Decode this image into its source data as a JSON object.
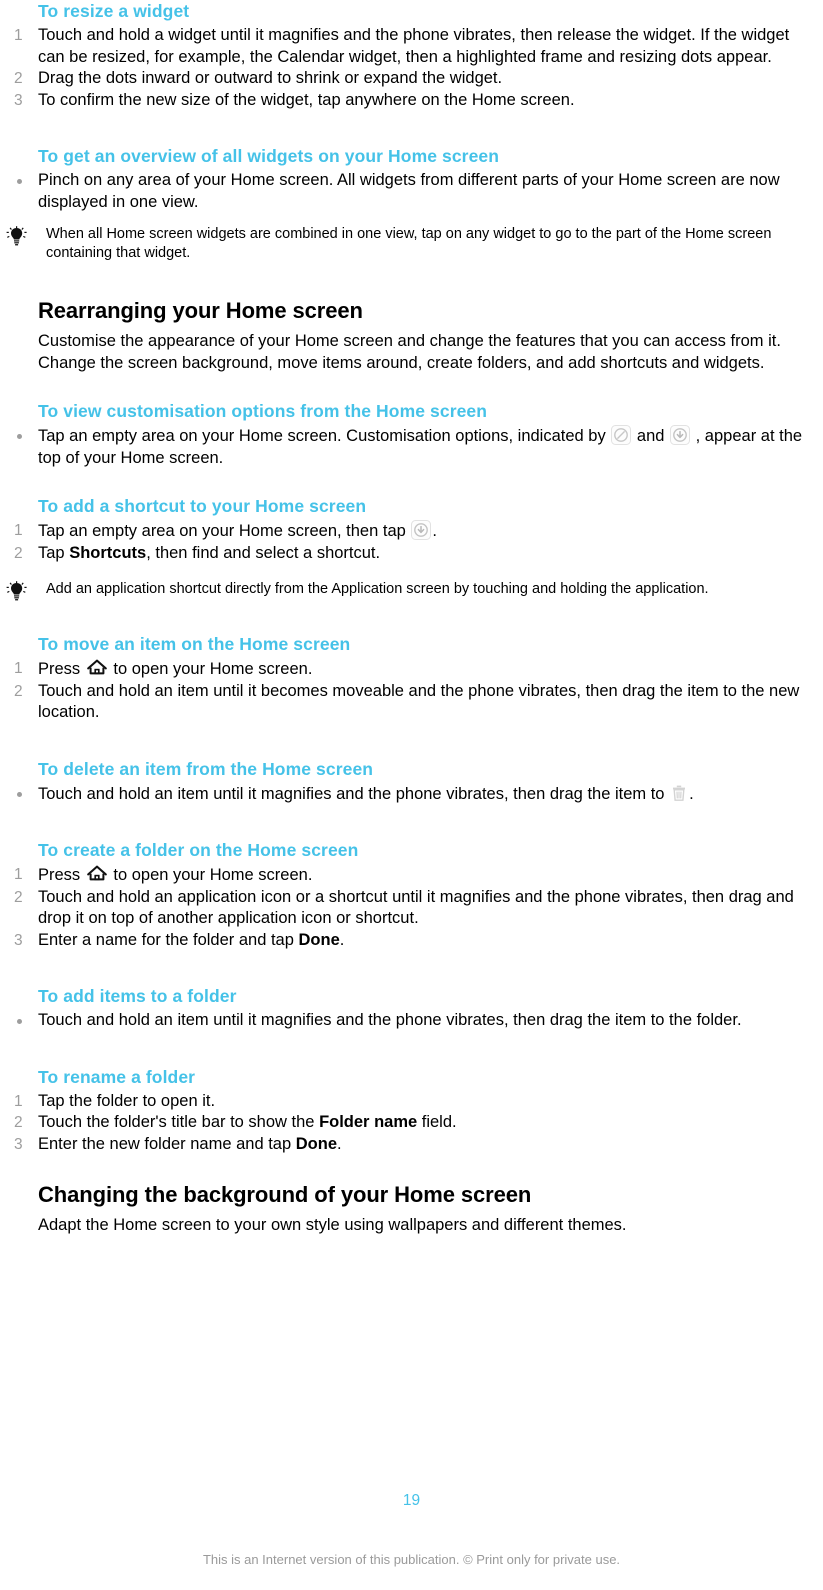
{
  "theme": {
    "heading_blue": "#45c2e8",
    "list_marker_grey": "#9d9d9d",
    "footer_grey": "#9a9a9a",
    "body_black": "#000000",
    "page_background": "#ffffff"
  },
  "sections": {
    "resize_widget": {
      "heading": "To resize a widget",
      "steps": [
        {
          "marker": "1",
          "text": "Touch and hold a widget until it magnifies and the phone vibrates, then release the widget. If the widget can be resized, for example, the Calendar widget, then a highlighted frame and resizing dots appear."
        },
        {
          "marker": "2",
          "text": "Drag the dots inward or outward to shrink or expand the widget."
        },
        {
          "marker": "3",
          "text": "To confirm the new size of the widget, tap anywhere on the Home screen."
        }
      ]
    },
    "overview_widgets": {
      "heading": "To get an overview of all widgets on your Home screen",
      "steps": [
        {
          "marker": "•",
          "text": "Pinch on any area of your Home screen. All widgets from different parts of your Home screen are now displayed in one view."
        }
      ],
      "tip": {
        "icon": "lightbulb-icon",
        "text": "When all Home screen widgets are combined in one view, tap on any widget to go to the part of the Home screen containing that widget."
      }
    },
    "rearranging": {
      "heading": "Rearranging your Home screen",
      "paragraph": "Customise the appearance of your Home screen and change the features that you can access from it. Change the screen background, move items around, create folders, and add shortcuts and widgets."
    },
    "view_customisation": {
      "heading": "To view customisation options from the Home screen",
      "step_prefix": "Tap an empty area on your Home screen. Customisation options, indicated by",
      "step_middle": "and",
      "step_suffix": ", appear at the top of your Home screen.",
      "icon_1": "theme-circle-slash-icon",
      "icon_2": "add-circle-icon",
      "marker": "•"
    },
    "add_shortcut": {
      "heading": "To add a shortcut to your Home screen",
      "step1_prefix": "Tap an empty area on your Home screen, then tap",
      "step1_icon": "add-circle-icon",
      "step1_suffix": ".",
      "step1_marker": "1",
      "step2_prefix": "Tap ",
      "step2_bold": "Shortcuts",
      "step2_suffix": ", then find and select a shortcut.",
      "step2_marker": "2",
      "tip": {
        "icon": "lightbulb-icon",
        "text": "Add an application shortcut directly from the Application screen by touching and holding the application."
      }
    },
    "move_item": {
      "heading": "To move an item on the Home screen",
      "step1_prefix": "Press",
      "step1_icon": "home-icon",
      "step1_suffix": "to open your Home screen.",
      "step1_marker": "1",
      "step2_marker": "2",
      "step2_text": "Touch and hold an item until it becomes moveable and the phone vibrates, then drag the item to the new location."
    },
    "delete_item": {
      "heading": "To delete an item from the Home screen",
      "marker": "•",
      "text_prefix": "Touch and hold an item until it magnifies and the phone vibrates, then drag the item to",
      "icon": "trash-bin-icon",
      "text_suffix": "."
    },
    "create_folder": {
      "heading": "To create a folder on the Home screen",
      "step1_prefix": "Press",
      "step1_icon": "home-icon",
      "step1_suffix": "to open your Home screen.",
      "step1_marker": "1",
      "step2_marker": "2",
      "step2_text": "Touch and hold an application icon or a shortcut until it magnifies and the phone vibrates, then drag and drop it on top of another application icon or shortcut.",
      "step3_marker": "3",
      "step3_prefix": "Enter a name for the folder and tap ",
      "step3_bold": "Done",
      "step3_suffix": "."
    },
    "add_items_folder": {
      "heading": "To add items to a folder",
      "marker": "•",
      "text": "Touch and hold an item until it magnifies and the phone vibrates, then drag the item to the folder."
    },
    "rename_folder": {
      "heading": "To rename a folder",
      "step1_marker": "1",
      "step1_text": "Tap the folder to open it.",
      "step2_marker": "2",
      "step2_prefix": "Touch the folder's title bar to show the ",
      "step2_bold": "Folder name",
      "step2_suffix": " field.",
      "step3_marker": "3",
      "step3_prefix": "Enter the new folder name and tap ",
      "step3_bold": "Done",
      "step3_suffix": "."
    },
    "changing_background": {
      "heading": "Changing the background of your Home screen",
      "paragraph": "Adapt the Home screen to your own style using wallpapers and different themes."
    }
  },
  "footer": {
    "page_number": "19",
    "note": "This is an Internet version of this publication. © Print only for private use."
  }
}
